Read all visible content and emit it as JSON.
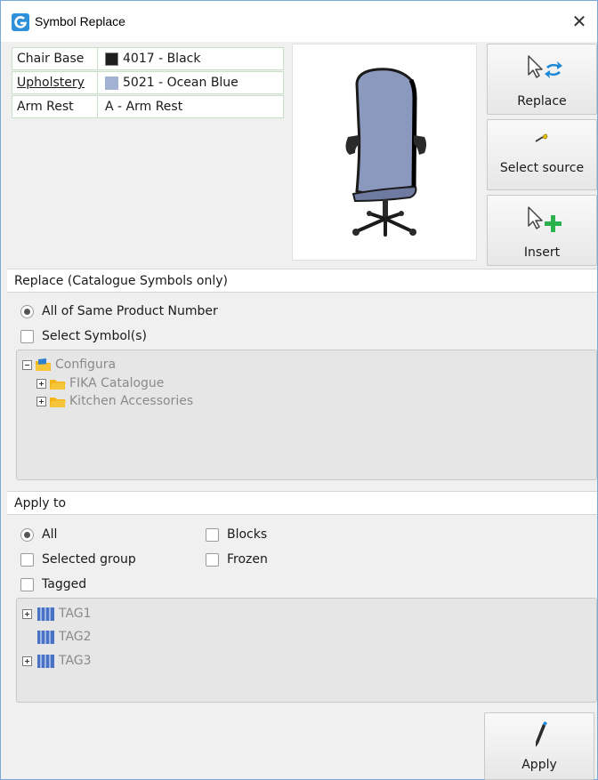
{
  "window": {
    "title": "Symbol Replace",
    "close_glyph": "✕",
    "accent": "#2f8fd8"
  },
  "attributes": [
    {
      "label": "Chair Base",
      "value": "4017 - Black",
      "swatch": "#1e1e1e",
      "link": false
    },
    {
      "label": "Upholstery",
      "value": "5021 - Ocean Blue",
      "swatch": "#a3b2d2",
      "link": true
    },
    {
      "label": "Arm Rest",
      "value": "A - Arm Rest",
      "swatch": null,
      "link": false
    }
  ],
  "actions": {
    "replace": {
      "label": "Replace",
      "icon": "cursor-swap-icon"
    },
    "select_source": {
      "label": "Select source",
      "icon": "picker-icon"
    },
    "insert": {
      "label": "Insert",
      "icon": "cursor-plus-icon"
    },
    "apply": {
      "label": "Apply",
      "icon": "pen-icon"
    }
  },
  "replace_section": {
    "header": "Replace (Catalogue Symbols only)",
    "options": [
      {
        "label": "All of Same Product Number",
        "type": "radio",
        "checked": true
      },
      {
        "label": "Select Symbol(s)",
        "type": "checkbox",
        "checked": false
      }
    ],
    "tree": [
      {
        "label": "Configura",
        "expanded": true,
        "level": 0
      },
      {
        "label": "FIKA Catalogue",
        "expanded": false,
        "level": 1
      },
      {
        "label": "Kitchen Accessories",
        "expanded": false,
        "level": 1
      }
    ]
  },
  "apply_section": {
    "header": "Apply to",
    "options": [
      {
        "label": "All",
        "type": "radio",
        "checked": true
      },
      {
        "label": "Blocks",
        "type": "checkbox",
        "checked": false
      },
      {
        "label": "Selected group",
        "type": "checkbox",
        "checked": false
      },
      {
        "label": "Frozen",
        "type": "checkbox",
        "checked": false
      },
      {
        "label": "Tagged",
        "type": "checkbox",
        "checked": false
      }
    ],
    "tags": [
      {
        "label": "TAG1",
        "expandable": true
      },
      {
        "label": "TAG2",
        "expandable": false
      },
      {
        "label": "TAG3",
        "expandable": true
      }
    ]
  }
}
